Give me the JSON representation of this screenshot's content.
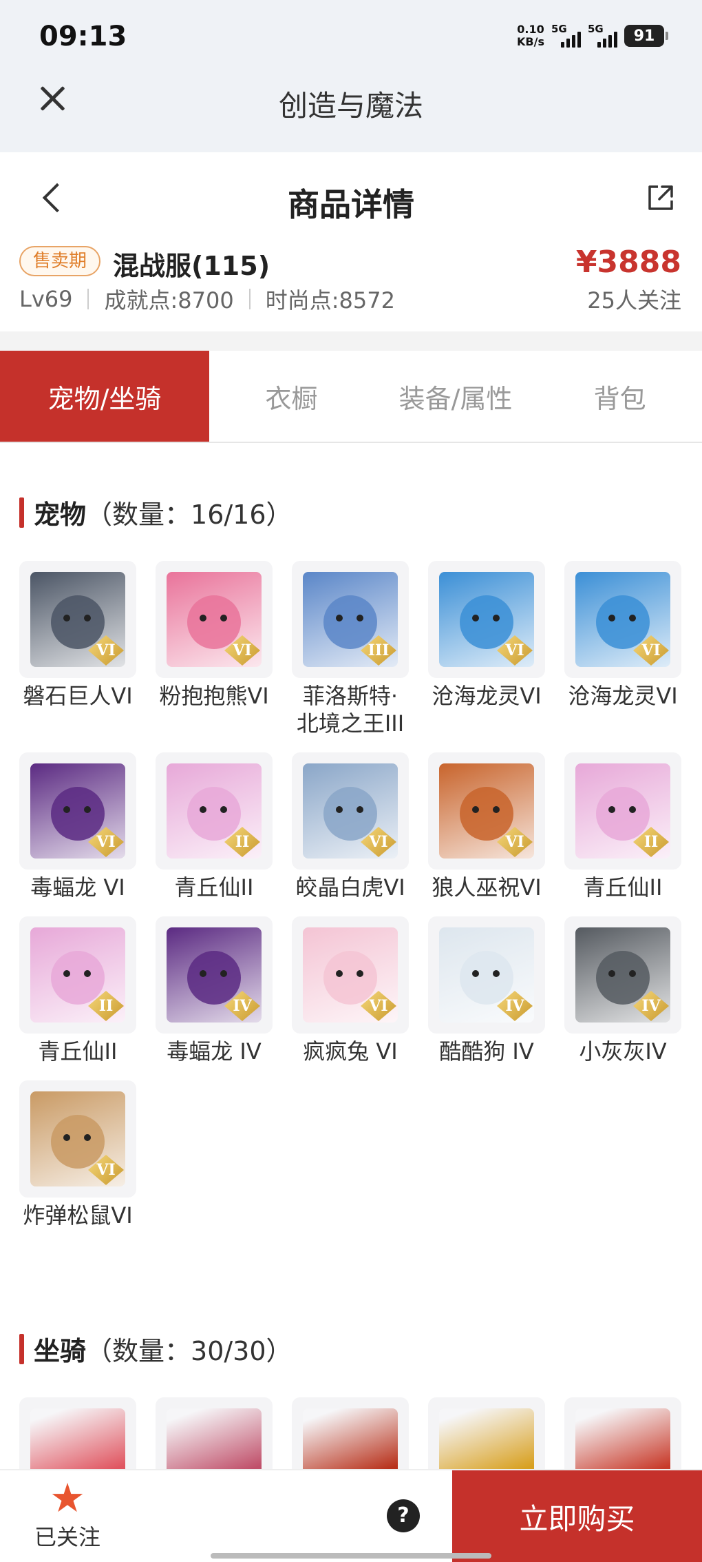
{
  "status_bar": {
    "time": "09:13",
    "net_speed_value": "0.10",
    "net_speed_unit": "KB/s",
    "sig1_label": "5G",
    "sig2_label": "5G",
    "battery": "91"
  },
  "app": {
    "title": "创造与魔法"
  },
  "header": {
    "title": "商品详情"
  },
  "product": {
    "badge": "售卖期",
    "server": "混战服(115)",
    "price": "¥3888",
    "level": "Lv69",
    "achievement": "成就点:8700",
    "fashion": "时尚点:8572",
    "followers": "25人关注"
  },
  "tabs": [
    {
      "label": "宠物/坐骑",
      "active": true
    },
    {
      "label": "衣橱",
      "active": false
    },
    {
      "label": "装备/属性",
      "active": false
    },
    {
      "label": "背包",
      "active": false
    }
  ],
  "pets_section": {
    "title": "宠物",
    "count": "（数量：16/16）"
  },
  "pets": [
    {
      "name": "磐石巨人VI",
      "grade": "VI",
      "color": "#4b5565"
    },
    {
      "name": "粉抱抱熊VI",
      "grade": "VI",
      "color": "#e9739a"
    },
    {
      "name": "菲洛斯特·北境之王III",
      "grade": "III",
      "color": "#5a86c8"
    },
    {
      "name": "沧海龙灵VI",
      "grade": "VI",
      "color": "#3b8fd6"
    },
    {
      "name": "沧海龙灵VI",
      "grade": "VI",
      "color": "#3b8fd6"
    },
    {
      "name": "毒蝠龙 VI",
      "grade": "VI",
      "color": "#5b2a82"
    },
    {
      "name": "青丘仙II",
      "grade": "II",
      "color": "#e7a8d8"
    },
    {
      "name": "皎晶白虎VI",
      "grade": "VI",
      "color": "#8aa6c8"
    },
    {
      "name": "狼人巫祝VI",
      "grade": "VI",
      "color": "#c8642c"
    },
    {
      "name": "青丘仙II",
      "grade": "II",
      "color": "#e7a8d8"
    },
    {
      "name": "青丘仙II",
      "grade": "II",
      "color": "#e7a8d8"
    },
    {
      "name": "毒蝠龙 IV",
      "grade": "IV",
      "color": "#5b2a82"
    },
    {
      "name": "疯疯兔 VI",
      "grade": "VI",
      "color": "#f4c4d4"
    },
    {
      "name": "酷酷狗 IV",
      "grade": "IV",
      "color": "#dde6ee"
    },
    {
      "name": "小灰灰IV",
      "grade": "IV",
      "color": "#555a60"
    },
    {
      "name": "炸弹松鼠VI",
      "grade": "VI",
      "color": "#c99a64"
    }
  ],
  "mounts_section": {
    "title": "坐骑",
    "count": "（数量：30/30）"
  },
  "mounts": [
    {
      "color": "#e05560"
    },
    {
      "color": "#c0506a"
    },
    {
      "color": "#b8321c"
    },
    {
      "color": "#d8a020"
    },
    {
      "color": "#c83a2a"
    }
  ],
  "bottom": {
    "follow_label": "已关注",
    "help": "?",
    "buy_label": "立即购买"
  }
}
